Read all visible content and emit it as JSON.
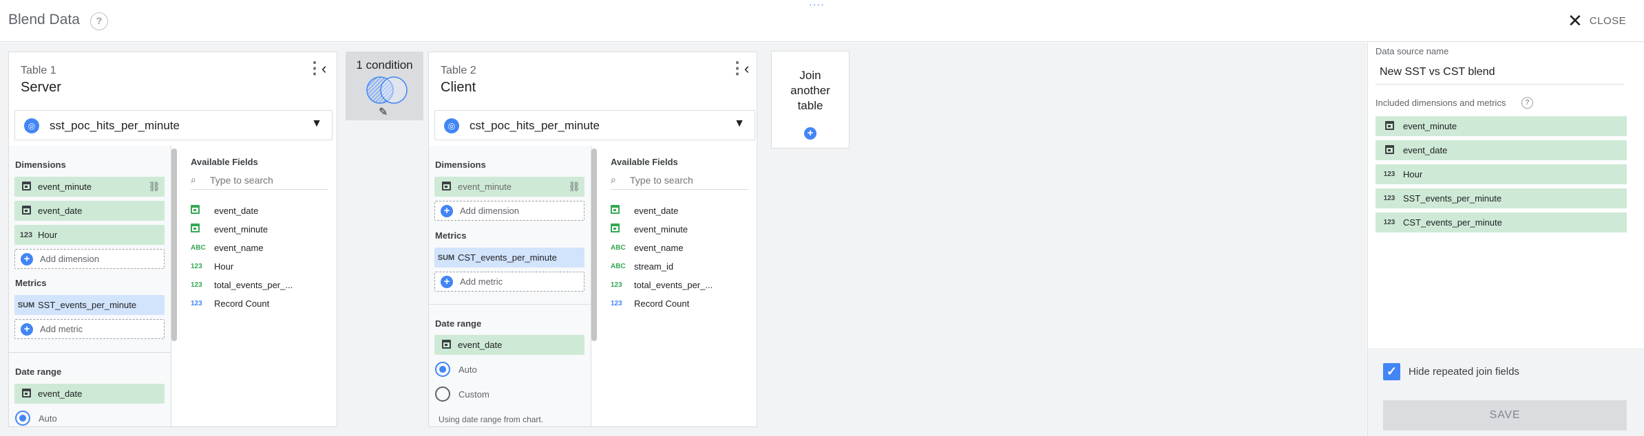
{
  "header": {
    "title": "Blend Data",
    "help_icon": "?",
    "close_label": "CLOSE",
    "close_icon": "✕"
  },
  "table1": {
    "number_label": "Table 1",
    "name": "Server",
    "data_source": "sst_poc_hits_per_minute",
    "dimensions_title": "Dimensions",
    "dimensions": [
      {
        "label": "event_minute",
        "type": "date"
      },
      {
        "label": "event_date",
        "type": "date"
      },
      {
        "label": "Hour",
        "type": "123"
      }
    ],
    "add_dimension": "Add dimension",
    "metrics_title": "Metrics",
    "metrics": [
      {
        "label": "SST_events_per_minute",
        "type": "SUM"
      }
    ],
    "add_metric": "Add metric",
    "date_range_title": "Date range",
    "date_range_field": "event_date",
    "radio_auto": "Auto",
    "available_title": "Available Fields",
    "search_placeholder": "Type to search",
    "available_fields": [
      {
        "label": "event_date",
        "type": "date"
      },
      {
        "label": "event_minute",
        "type": "date"
      },
      {
        "label": "event_name",
        "type": "ABC"
      },
      {
        "label": "Hour",
        "type": "123"
      },
      {
        "label": "total_events_per_...",
        "type": "123"
      },
      {
        "label": "Record Count",
        "type": "123"
      }
    ]
  },
  "join": {
    "conditions": "1 condition"
  },
  "table2": {
    "number_label": "Table 2",
    "name": "Client",
    "data_source": "cst_poc_hits_per_minute",
    "dimensions_title": "Dimensions",
    "dimensions": [
      {
        "label": "event_minute",
        "type": "date"
      }
    ],
    "add_dimension": "Add dimension",
    "metrics_title": "Metrics",
    "metrics": [
      {
        "label": "CST_events_per_minute",
        "type": "SUM"
      }
    ],
    "add_metric": "Add metric",
    "date_range_title": "Date range",
    "date_range_field": "event_date",
    "radio_auto": "Auto",
    "radio_custom": "Custom",
    "date_note": "Using date range from chart.",
    "available_title": "Available Fields",
    "search_placeholder": "Type to search",
    "available_fields": [
      {
        "label": "event_date",
        "type": "date"
      },
      {
        "label": "event_minute",
        "type": "date"
      },
      {
        "label": "event_name",
        "type": "ABC"
      },
      {
        "label": "stream_id",
        "type": "ABC"
      },
      {
        "label": "total_events_per_...",
        "type": "123"
      },
      {
        "label": "Record Count",
        "type": "123"
      }
    ]
  },
  "join_another": {
    "line1": "Join",
    "line2": "another",
    "line3": "table"
  },
  "side_panel": {
    "data_source_label": "Data source name",
    "data_source_name": "New SST vs CST blend",
    "included_label": "Included dimensions and metrics",
    "included": [
      {
        "label": "event_minute",
        "type": "date"
      },
      {
        "label": "event_date",
        "type": "date"
      },
      {
        "label": "Hour",
        "type": "123"
      },
      {
        "label": "SST_events_per_minute",
        "type": "123"
      },
      {
        "label": "CST_events_per_minute",
        "type": "123"
      }
    ],
    "hide_repeated_label": "Hide repeated join fields",
    "hide_repeated_checked": true,
    "save_label": "SAVE"
  },
  "colors": {
    "accent": "#4285f4",
    "dimension_chip": "#ceead6",
    "metric_chip": "#d2e3fc"
  },
  "icons": {
    "menu": "more-vert-icon",
    "collapse": "chevron-left-icon",
    "edit": "pencil-icon",
    "search": "search-icon",
    "link": "link-icon",
    "add": "plus-circle-icon"
  }
}
